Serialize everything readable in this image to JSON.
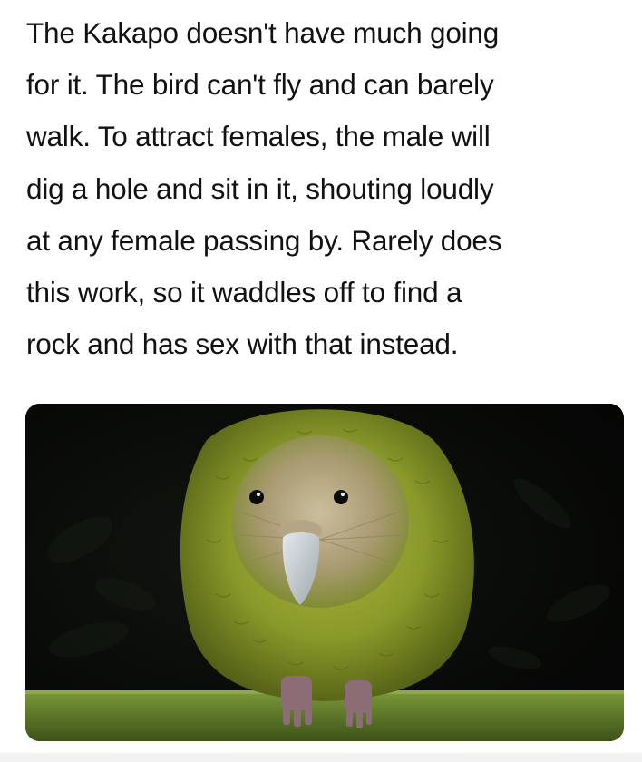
{
  "post": {
    "caption": "The Kakapo doesn't have much going\nfor it. The bird can't fly and can barely\nwalk. To attract females, the male will\ndig a hole and sit in it, shouting loudly\nat any female passing by. Rarely does\nthis work, so it waddles off to find a\nrock and has sex with that instead."
  },
  "photo": {
    "subject": "kakapo-bird",
    "colors": {
      "background": "#060706",
      "plumage": "#8a9a2a",
      "plumage_dark": "#4f5a14",
      "face": "#b7a98c",
      "beak": "#c9cfd2",
      "ledge": "#5e7a2c"
    }
  }
}
